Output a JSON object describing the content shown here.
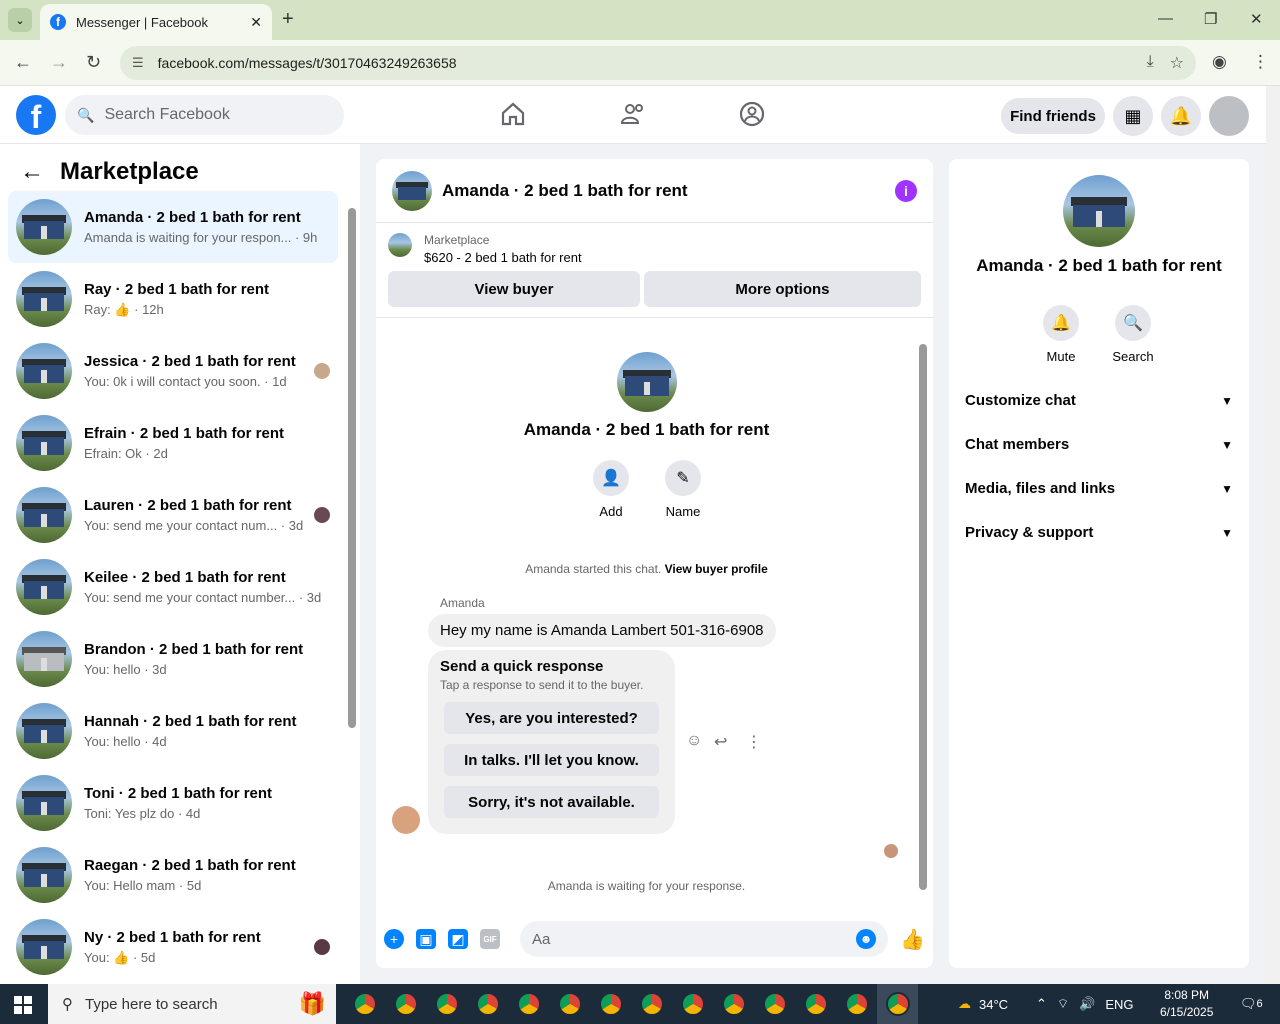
{
  "browser": {
    "tab_title": "Messenger | Facebook",
    "url": "facebook.com/messages/t/30170463249263658"
  },
  "fb": {
    "search_placeholder": "Search Facebook",
    "find_friends": "Find friends"
  },
  "sidebar": {
    "title": "Marketplace",
    "conversations": [
      {
        "name": "Amanda · 2 bed 1 bath for rent",
        "preview": "Amanda is waiting for your respon... · 9h",
        "active": true
      },
      {
        "name": "Ray · 2 bed 1 bath for rent",
        "preview": "Ray: 👍 · 12h"
      },
      {
        "name": "Jessica · 2 bed 1 bath for rent",
        "preview": "You: 0k i will contact you soon. · 1d"
      },
      {
        "name": "Efrain · 2 bed 1 bath for rent",
        "preview": "Efrain: Ok · 2d"
      },
      {
        "name": "Lauren · 2 bed 1 bath for rent",
        "preview": "You: send me your contact num... · 3d"
      },
      {
        "name": "Keilee · 2 bed 1 bath for rent",
        "preview": "You: send me your contact number... · 3d"
      },
      {
        "name": "Brandon · 2 bed 1 bath for rent",
        "preview": "You: hello · 3d"
      },
      {
        "name": "Hannah · 2 bed 1 bath for rent",
        "preview": "You: hello · 4d"
      },
      {
        "name": "Toni · 2 bed 1 bath for rent",
        "preview": "Toni: Yes plz do · 4d"
      },
      {
        "name": "Raegan · 2 bed 1 bath for rent",
        "preview": "You: Hello mam · 5d"
      },
      {
        "name": "Ny · 2 bed 1 bath for rent",
        "preview": "You: 👍 · 5d"
      }
    ]
  },
  "chat": {
    "title": "Amanda · 2 bed 1 bath for rent",
    "listing_label": "Marketplace",
    "listing_title": "$620 - 2 bed 1 bath for rent",
    "view_buyer": "View buyer",
    "more_options": "More options",
    "profile_name": "Amanda · 2 bed 1 bath for rent",
    "add_label": "Add",
    "name_label": "Name",
    "started_text": "Amanda started this chat.",
    "view_buyer_profile": "View buyer profile",
    "sender": "Amanda",
    "message": "Hey my name is Amanda Lambert 501-316-6908",
    "quick_title": "Send a quick response",
    "quick_sub": "Tap a response to send it to the buyer.",
    "quick_options": [
      "Yes, are you interested?",
      "In talks. I'll let you know.",
      "Sorry, it's not available."
    ],
    "waiting_text": "Amanda is waiting for your response.",
    "composer_placeholder": "Aa"
  },
  "info": {
    "name": "Amanda · 2 bed 1 bath for rent",
    "mute": "Mute",
    "search": "Search",
    "sections": [
      "Customize chat",
      "Chat members",
      "Media, files and links",
      "Privacy & support"
    ]
  },
  "taskbar": {
    "search_placeholder": "Type here to search",
    "weather": "34°C",
    "lang": "ENG",
    "time": "8:08 PM",
    "date": "6/15/2025",
    "notifications": "6"
  }
}
